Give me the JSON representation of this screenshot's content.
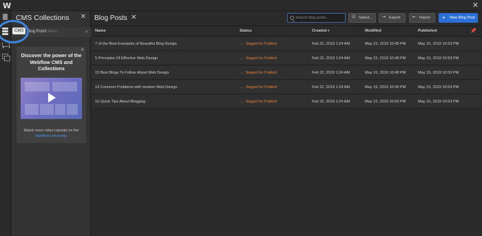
{
  "app": {
    "logo": "W",
    "close": "✕"
  },
  "rail": {
    "tooltip": "CMS"
  },
  "collections_panel": {
    "title": "CMS Collections",
    "close": "✕",
    "item": {
      "label": "Blog Posts",
      "count": "5 items",
      "chevron": "›"
    },
    "promo": {
      "close": "✕",
      "title": "Discover the power of the Webflow CMS and Collections",
      "caption": "Watch more video tutorials on the",
      "link": "Webflow University",
      "link_suffix": "."
    }
  },
  "main": {
    "title": "Blog Posts",
    "close": "✕",
    "search_placeholder": "Search blog posts...",
    "buttons": {
      "select": "Select...",
      "export": "Export",
      "import": "Import",
      "new": "New Blog Post"
    },
    "columns": {
      "name": "Name",
      "status": "Status",
      "created": "Created",
      "modified": "Modified",
      "published": "Published"
    },
    "rows": [
      {
        "name": "7 of the Best Examples of Beautiful Blog Design",
        "status": "Staged for Publish",
        "created": "Feb 22, 2019 1:24 AM",
        "modified": "May 15, 2019 10:49 PM",
        "published": "May 15, 2019 10:53 PM"
      },
      {
        "name": "5 Principles Of Effective Web Design",
        "status": "Staged for Publish",
        "created": "Feb 22, 2019 1:24 AM",
        "modified": "May 15, 2019 10:49 PM",
        "published": "May 15, 2019 10:53 PM"
      },
      {
        "name": "15 Best Blogs To Follow About Web Design",
        "status": "Staged for Publish",
        "created": "Feb 22, 2019 1:24 AM",
        "modified": "May 15, 2019 10:49 PM",
        "published": "May 15, 2019 10:53 PM"
      },
      {
        "name": "14 Common Problems with modern Web Design",
        "status": "Staged for Publish",
        "created": "Feb 22, 2019 1:24 AM",
        "modified": "May 15, 2019 10:49 PM",
        "published": "May 15, 2019 10:53 PM"
      },
      {
        "name": "10 Quick Tips About Blogging",
        "status": "Staged for Publish",
        "created": "Feb 22, 2019 1:24 AM",
        "modified": "May 15, 2019 10:50 PM",
        "published": "May 15, 2019 10:53 PM"
      }
    ]
  },
  "colors": {
    "accent": "#2b6fd6",
    "status_staged": "#e8823a",
    "highlight": "#3b86e0",
    "link": "#4b9ae6"
  }
}
